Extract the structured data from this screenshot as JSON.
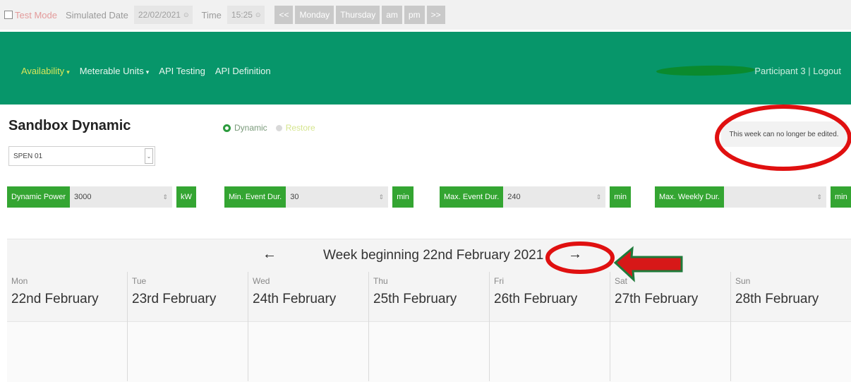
{
  "testbar": {
    "test_mode": "Test Mode",
    "simulated_date_label": "Simulated Date",
    "simulated_date_value": "22/02/2021",
    "time_label": "Time",
    "time_value": "15:25",
    "buttons": [
      "<<",
      "Monday",
      "Thursday",
      "am",
      "pm",
      ">>"
    ]
  },
  "nav": {
    "links": [
      "Availability",
      "Meterable Units",
      "API Testing",
      "API Definition"
    ],
    "user": "Participant 3 | Logout"
  },
  "page": {
    "title": "Sandbox Dynamic",
    "unit": "SPEN 01",
    "radio_dynamic": "Dynamic",
    "radio_restore": "Restore",
    "notice": "This week can no longer be edited."
  },
  "params": [
    {
      "label": "Dynamic Power",
      "value": "3000",
      "unit": "kW"
    },
    {
      "label": "Min. Event Dur.",
      "value": "30",
      "unit": "min"
    },
    {
      "label": "Max. Event Dur.",
      "value": "240",
      "unit": "min"
    },
    {
      "label": "Max. Weekly Dur.",
      "value": "",
      "unit": "min"
    }
  ],
  "calendar": {
    "week_title": "Week beginning 22nd February 2021",
    "prev_arrow": "←",
    "next_arrow": "→",
    "days": [
      {
        "name": "Mon",
        "date": "22nd February"
      },
      {
        "name": "Tue",
        "date": "23rd February"
      },
      {
        "name": "Wed",
        "date": "24th February"
      },
      {
        "name": "Thu",
        "date": "25th February"
      },
      {
        "name": "Fri",
        "date": "26th February"
      },
      {
        "name": "Sat",
        "date": "27th February"
      },
      {
        "name": "Sun",
        "date": "28th February"
      }
    ]
  },
  "colors": {
    "nav_green": "#07966a",
    "button_green": "#34a532",
    "annotation_red": "#e01010"
  }
}
